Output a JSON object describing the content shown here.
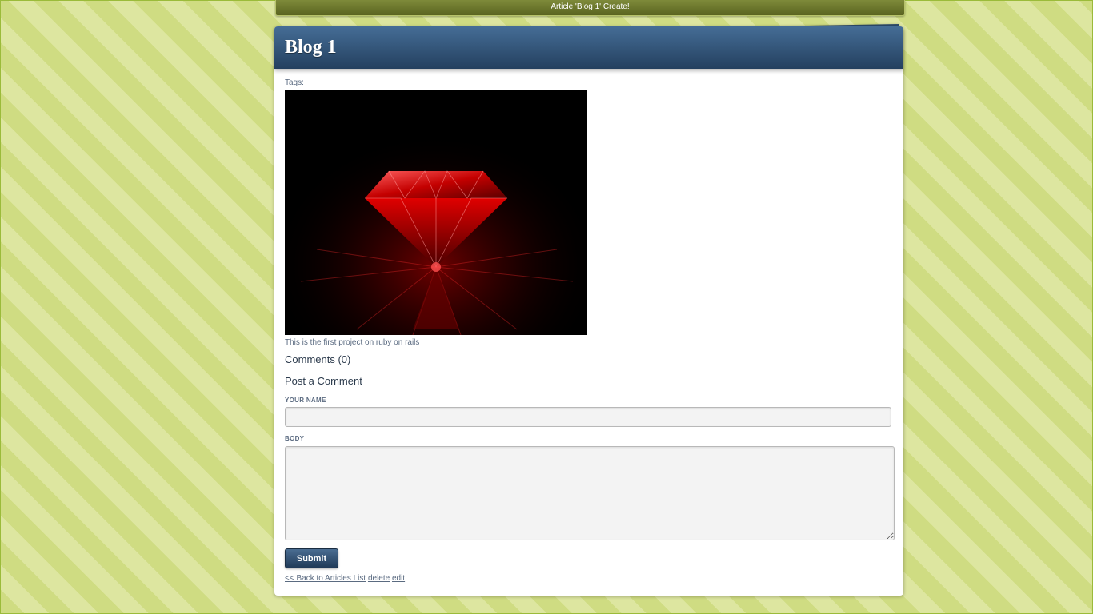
{
  "flash": {
    "message": "Article 'Blog 1' Create!"
  },
  "article": {
    "title": "Blog 1",
    "tags_label": "Tags:",
    "image_subject": "red-diamond",
    "body": "This is the first project on ruby on rails"
  },
  "comments": {
    "heading": "Comments (0)"
  },
  "comment_form": {
    "heading": "Post a Comment",
    "name_label": "YOUR NAME",
    "name_value": "",
    "body_label": "BODY",
    "body_value": "",
    "submit_label": "Submit"
  },
  "links": {
    "back": "<< Back to Articles List",
    "delete": "delete",
    "edit": "edit"
  },
  "colors": {
    "header": "#2c4a6a",
    "page_background": "#d6e08c",
    "flash_background": "#6b7530"
  }
}
